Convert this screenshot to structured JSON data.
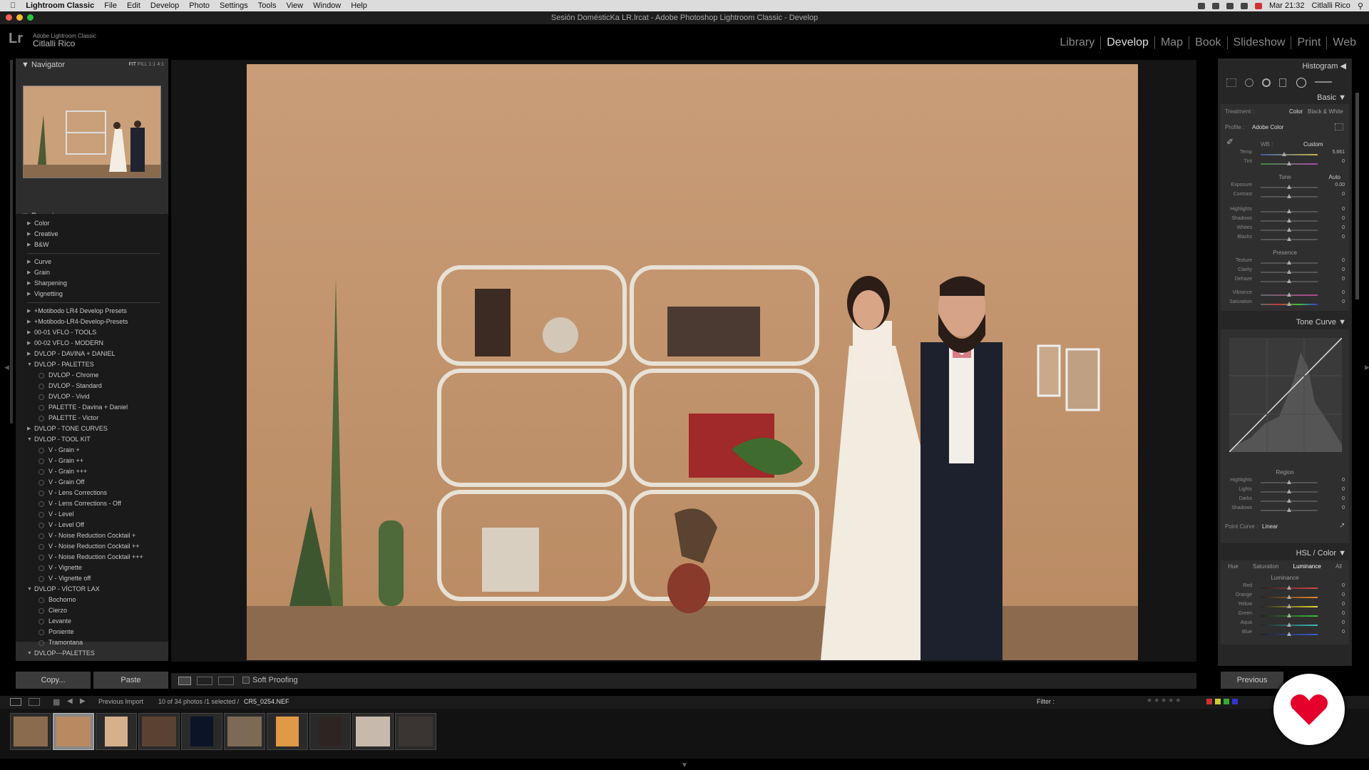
{
  "menubar": {
    "apple_icon": "apple-icon",
    "app_name": "Lightroom Classic",
    "menus": [
      "File",
      "Edit",
      "Develop",
      "Photo",
      "Settings",
      "Tools",
      "View",
      "Window",
      "Help"
    ],
    "clock": "Mar 21:32",
    "user": "Citlalli Rico"
  },
  "window": {
    "title": "Sesión DomésticKa LR.lrcat - Adobe Photoshop Lightroom Classic - Develop"
  },
  "identity": {
    "logo": "Lr",
    "product": "Adobe Lightroom Classic",
    "name": "Citlalli Rico"
  },
  "modules": {
    "items": [
      "Library",
      "Develop",
      "Map",
      "Book",
      "Slideshow",
      "Print",
      "Web"
    ],
    "active": "Develop"
  },
  "navigator": {
    "title": "Navigator",
    "zoom": [
      "FIT",
      "FILL",
      "1:1",
      "4:1"
    ]
  },
  "presets": {
    "title": "Presets",
    "add": "+",
    "groups_a": [
      "Color",
      "Creative",
      "B&W"
    ],
    "groups_b": [
      "Curve",
      "Grain",
      "Sharpening",
      "Vignetting"
    ],
    "groups_c": [
      "+Motibodo LR4 Develop Presets",
      "+Motibodo-LR4-Develop-Presets",
      "00-01 VFLO - TOOLS",
      "00-02 VFLO - MODERN",
      "DVLOP - DAVINA + DANIEL"
    ],
    "palettes_title": "DVLOP - PALETTES",
    "palettes": [
      "DVLOP - Chrome",
      "DVLOP - Standard",
      "DVLOP - Vivid",
      "PALETTE - Davina + Daniel",
      "PALETTE - Victor"
    ],
    "tone_curves": "DVLOP - TONE CURVES",
    "toolkit_title": "DVLOP - TOOL KIT",
    "toolkit": [
      "V - Grain +",
      "V - Grain ++",
      "V - Grain +++",
      "V - Grain Off",
      "V - Lens Corrections",
      "V - Lens Corrections - Off",
      "V - Level",
      "V - Level Off",
      "V - Noise Reduction Cocktail +",
      "V - Noise Reduction Cocktail ++",
      "V - Noise Reduction Cocktail +++",
      "V - Vignette",
      "V - Vignette off"
    ],
    "victor_title": "DVLOP - VÍCTOR LAX",
    "victor": [
      "Bochorno",
      "Cierzo",
      "Levante",
      "Poniente",
      "Tramontana"
    ],
    "last": "DVLOP---PALETTES"
  },
  "left_buttons": {
    "copy": "Copy...",
    "paste": "Paste"
  },
  "toolbar": {
    "soft_proofing": "Soft Proofing"
  },
  "right": {
    "histogram": "Histogram",
    "basic": "Basic",
    "treatment_label": "Treatment :",
    "treatment_color": "Color",
    "treatment_bw": "Black & White",
    "profile_label": "Profile :",
    "profile_value": "Adobe Color",
    "wb_label": "WB :",
    "wb_value": "Custom",
    "temp_label": "Temp",
    "temp_value": "5,661",
    "tint_label": "Tint",
    "tint_value": "0",
    "tone_label": "Tone",
    "auto": "Auto",
    "tone_rows": [
      {
        "label": "Exposure",
        "value": "0.00"
      },
      {
        "label": "Contrast",
        "value": "0"
      }
    ],
    "tone_rows2": [
      {
        "label": "Highlights",
        "value": "0"
      },
      {
        "label": "Shadows",
        "value": "0"
      },
      {
        "label": "Whites",
        "value": "0"
      },
      {
        "label": "Blacks",
        "value": "0"
      }
    ],
    "presence_label": "Presence",
    "presence_rows": [
      {
        "label": "Texture",
        "value": "0"
      },
      {
        "label": "Clarity",
        "value": "0"
      },
      {
        "label": "Dehaze",
        "value": "0"
      }
    ],
    "presence_rows2": [
      {
        "label": "Vibrance",
        "value": "0"
      },
      {
        "label": "Saturation",
        "value": "0"
      }
    ],
    "tone_curve": "Tone Curve",
    "region_label": "Region",
    "region_rows": [
      {
        "label": "Highlights",
        "value": "0"
      },
      {
        "label": "Lights",
        "value": "0"
      },
      {
        "label": "Darks",
        "value": "0"
      },
      {
        "label": "Shadows",
        "value": "0"
      }
    ],
    "point_curve_label": "Point Curve :",
    "point_curve_value": "Linear",
    "hsl_title": "HSL / Color",
    "hsl_tabs": [
      "Hue",
      "Saturation",
      "Luminance",
      "All"
    ],
    "luminance_label": "Luminance",
    "lum_rows": [
      {
        "label": "Red",
        "value": "0"
      },
      {
        "label": "Orange",
        "value": "0"
      },
      {
        "label": "Yellow",
        "value": "0"
      },
      {
        "label": "Green",
        "value": "0"
      },
      {
        "label": "Aqua",
        "value": "0"
      },
      {
        "label": "Blue",
        "value": "0"
      }
    ],
    "previous": "Previous"
  },
  "filmstrip_bar": {
    "source": "Previous Import",
    "count": "10 of 34 photos /1 selected /",
    "filename": "CR5_0254.NEF",
    "filter": "Filter :"
  },
  "colors": {
    "accent": "#d9d9d9",
    "panel": "#2d2d2d",
    "logo_red": "#e4002b"
  }
}
